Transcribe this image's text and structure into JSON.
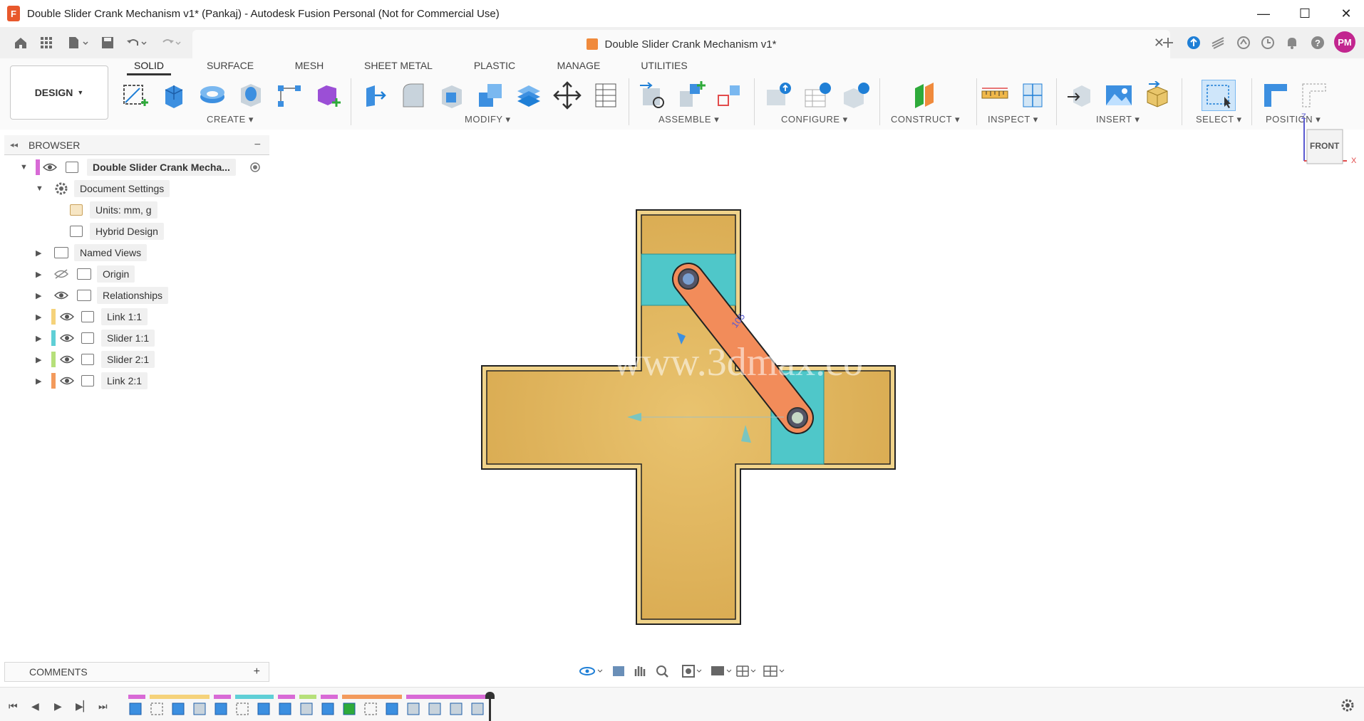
{
  "window": {
    "title": "Double Slider Crank Mechanism v1* (Pankaj) - Autodesk Fusion Personal (Not for Commercial Use)",
    "app_icon_letter": "F",
    "minimize": "—",
    "maximize": "☐",
    "close": "✕"
  },
  "doc_tab": {
    "title": "Double Slider Crank Mechanism v1*",
    "close": "✕"
  },
  "user": {
    "initials": "PM"
  },
  "workspace": {
    "mode": "DESIGN"
  },
  "toolbar_tabs": [
    "SOLID",
    "SURFACE",
    "MESH",
    "SHEET METAL",
    "PLASTIC",
    "MANAGE",
    "UTILITIES"
  ],
  "toolbar_groups": [
    "CREATE",
    "MODIFY",
    "ASSEMBLE",
    "CONFIGURE",
    "CONSTRUCT",
    "INSPECT",
    "INSERT",
    "SELECT",
    "POSITION"
  ],
  "browser": {
    "title": "BROWSER",
    "root": "Double Slider Crank Mecha...",
    "items": [
      {
        "label": "Document Settings"
      },
      {
        "label": "Units: mm, g"
      },
      {
        "label": "Hybrid Design"
      },
      {
        "label": "Named Views"
      },
      {
        "label": "Origin"
      },
      {
        "label": "Relationships"
      },
      {
        "label": "Link 1:1",
        "color": "#f5d27a"
      },
      {
        "label": "Slider 1:1",
        "color": "#5fcfd6"
      },
      {
        "label": "Slider 2:1",
        "color": "#b6e07a"
      },
      {
        "label": "Link 2:1",
        "color": "#f39a5c"
      }
    ]
  },
  "viewcube": {
    "face": "FRONT",
    "axis_z": "Z",
    "axis_x": "X"
  },
  "viewport": {
    "dimension_label": "105",
    "watermark": "www.3dmax.co"
  },
  "comments": {
    "label": "COMMENTS",
    "add": "+"
  },
  "colors": {
    "frame": "#e3b65c",
    "frame_dark": "#c99a3f",
    "slider": "#4fc7c9",
    "link": "#f28c5a",
    "accent_blue": "#1f7fd6"
  }
}
